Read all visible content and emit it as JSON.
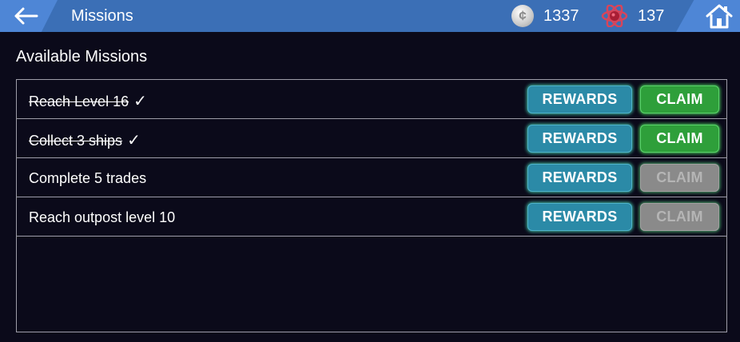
{
  "header": {
    "title": "Missions",
    "back_icon": "back-arrow-icon",
    "home_icon": "home-icon",
    "coins": "1337",
    "coin_symbol": "¢",
    "gems": "137"
  },
  "main": {
    "heading": "Available Missions",
    "missions": [
      {
        "label": "Reach Level 16",
        "completed": true,
        "check": "✓",
        "rewards_label": "REWARDS",
        "claim_label": "CLAIM",
        "claim_enabled": true
      },
      {
        "label": "Collect 3 ships",
        "completed": true,
        "check": "✓",
        "rewards_label": "REWARDS",
        "claim_label": "CLAIM",
        "claim_enabled": true
      },
      {
        "label": "Complete 5 trades",
        "completed": false,
        "check": "",
        "rewards_label": "REWARDS",
        "claim_label": "CLAIM",
        "claim_enabled": false
      },
      {
        "label": "Reach outpost level 10",
        "completed": false,
        "check": "",
        "rewards_label": "REWARDS",
        "claim_label": "CLAIM",
        "claim_enabled": false
      }
    ]
  },
  "colors": {
    "topbar": "#3b6fb6",
    "background": "#0b0a1a",
    "rewards_button": "#2b8aa7",
    "claim_enabled": "#2e9f3a",
    "claim_disabled": "#8a8a8a"
  }
}
